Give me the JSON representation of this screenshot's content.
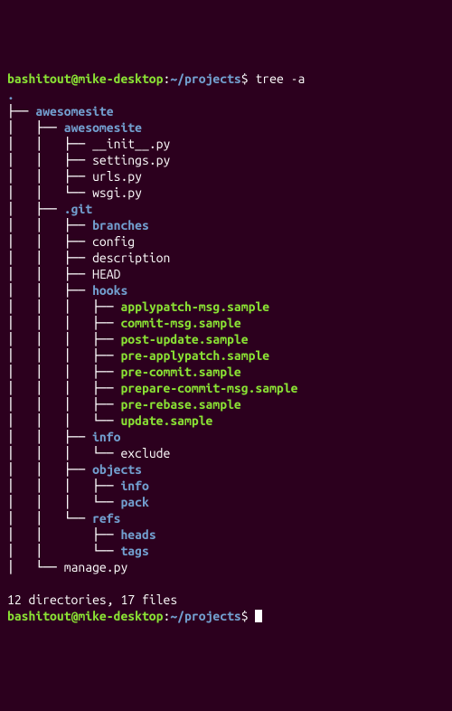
{
  "prompt1": {
    "user": "bashitout",
    "at": "@",
    "host": "mike-desktop",
    "colon": ":",
    "path": "~/projects",
    "dollar": "$ ",
    "command": "tree -a"
  },
  "lines": [
    {
      "prefix": "",
      "name": ".",
      "cls": "dir"
    },
    {
      "prefix": "├── ",
      "name": "awesomesite",
      "cls": "dir"
    },
    {
      "prefix": "│   ├── ",
      "name": "awesomesite",
      "cls": "dir"
    },
    {
      "prefix": "│   │   ├── ",
      "name": "__init__.py",
      "cls": "plain"
    },
    {
      "prefix": "│   │   ├── ",
      "name": "settings.py",
      "cls": "plain"
    },
    {
      "prefix": "│   │   ├── ",
      "name": "urls.py",
      "cls": "plain"
    },
    {
      "prefix": "│   │   └── ",
      "name": "wsgi.py",
      "cls": "plain"
    },
    {
      "prefix": "│   ├── ",
      "name": ".git",
      "cls": "dir"
    },
    {
      "prefix": "│   │   ├── ",
      "name": "branches",
      "cls": "dir"
    },
    {
      "prefix": "│   │   ├── ",
      "name": "config",
      "cls": "plain"
    },
    {
      "prefix": "│   │   ├── ",
      "name": "description",
      "cls": "plain"
    },
    {
      "prefix": "│   │   ├── ",
      "name": "HEAD",
      "cls": "plain"
    },
    {
      "prefix": "│   │   ├── ",
      "name": "hooks",
      "cls": "dir"
    },
    {
      "prefix": "│   │   │   ├── ",
      "name": "applypatch-msg.sample",
      "cls": "exec"
    },
    {
      "prefix": "│   │   │   ├── ",
      "name": "commit-msg.sample",
      "cls": "exec"
    },
    {
      "prefix": "│   │   │   ├── ",
      "name": "post-update.sample",
      "cls": "exec"
    },
    {
      "prefix": "│   │   │   ├── ",
      "name": "pre-applypatch.sample",
      "cls": "exec"
    },
    {
      "prefix": "│   │   │   ├── ",
      "name": "pre-commit.sample",
      "cls": "exec"
    },
    {
      "prefix": "│   │   │   ├── ",
      "name": "prepare-commit-msg.sample",
      "cls": "exec"
    },
    {
      "prefix": "│   │   │   ├── ",
      "name": "pre-rebase.sample",
      "cls": "exec"
    },
    {
      "prefix": "│   │   │   └── ",
      "name": "update.sample",
      "cls": "exec"
    },
    {
      "prefix": "│   │   ├── ",
      "name": "info",
      "cls": "dir"
    },
    {
      "prefix": "│   │   │   └── ",
      "name": "exclude",
      "cls": "plain"
    },
    {
      "prefix": "│   │   ├── ",
      "name": "objects",
      "cls": "dir"
    },
    {
      "prefix": "│   │   │   ├── ",
      "name": "info",
      "cls": "dir"
    },
    {
      "prefix": "│   │   │   └── ",
      "name": "pack",
      "cls": "dir"
    },
    {
      "prefix": "│   │   └── ",
      "name": "refs",
      "cls": "dir"
    },
    {
      "prefix": "│   │       ├── ",
      "name": "heads",
      "cls": "dir"
    },
    {
      "prefix": "│   │       └── ",
      "name": "tags",
      "cls": "dir"
    },
    {
      "prefix": "│   └── ",
      "name": "manage.py",
      "cls": "plain"
    }
  ],
  "summary": "12 directories, 17 files",
  "prompt2": {
    "user": "bashitout",
    "at": "@",
    "host": "mike-desktop",
    "colon": ":",
    "path": "~/projects",
    "dollar": "$ "
  }
}
